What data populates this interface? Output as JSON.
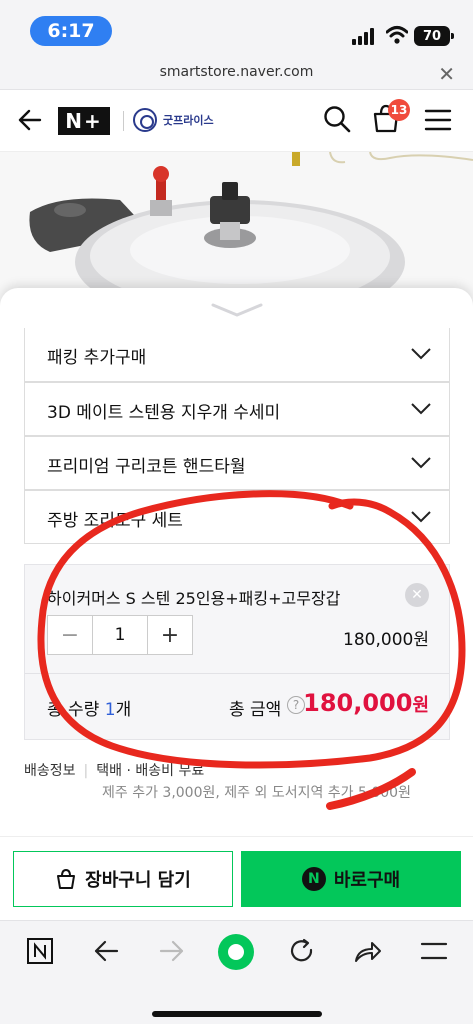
{
  "status_bar": {
    "time": "6:17",
    "battery": "70"
  },
  "browser": {
    "url": "smartstore.naver.com",
    "close_glyph": "✕"
  },
  "header": {
    "logo_text": "N+",
    "store_name": "굿프라이스",
    "cart_count": "13"
  },
  "options": [
    {
      "label": "패킹 추가구매"
    },
    {
      "label": "3D 메이트 스텐용 지우개 수세미"
    },
    {
      "label": "프리미엄 구리코튼 핸드타월"
    },
    {
      "label": "주방 조리도구 세트"
    }
  ],
  "selected_item": {
    "name": "하이커머스 S 스텐 25인용+패킹+고무장갑",
    "remove_glyph": "✕",
    "minus_glyph": "−",
    "quantity": "1",
    "plus_glyph": "+",
    "price": "180,000원"
  },
  "totals": {
    "qty_label": "총 수량 ",
    "qty_value": "1",
    "qty_unit": "개",
    "amount_label": "총 금액",
    "help_glyph": "?",
    "amount": "180,000",
    "amount_unit": "원"
  },
  "shipping": {
    "label": "배송정보",
    "value": "택배 · 배송비 무료",
    "extra": "제주 추가 3,000원, 제주 외 도서지역 추가 5,000원"
  },
  "actions": {
    "cart_label": "장바구니 담기",
    "buy_label": "바로구매",
    "buy_icon_glyph": "N"
  },
  "colors": {
    "accent_green": "#03c75a",
    "price_red": "#e0123f",
    "badge_red": "#f04b3c",
    "annotation_red": "#e8281e"
  }
}
